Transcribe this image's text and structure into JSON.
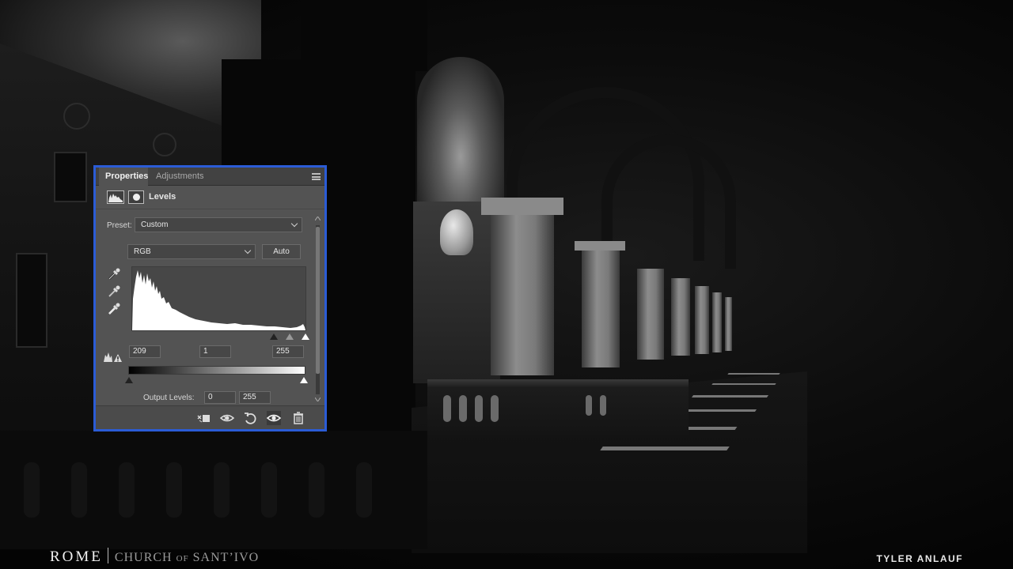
{
  "panel": {
    "tabs": [
      {
        "label": "Properties",
        "active": true
      },
      {
        "label": "Adjustments",
        "active": false
      }
    ],
    "menu_icon": "panel-menu-icon",
    "title": "Levels",
    "preset_label": "Preset:",
    "preset_value": "Custom",
    "channel_value": "RGB",
    "auto_label": "Auto",
    "input_black": "209",
    "input_gamma": "1",
    "input_white": "255",
    "output_label": "Output Levels:",
    "output_black": "0",
    "output_white": "255",
    "footer_icons": [
      "clip-to-layer-icon",
      "view-previous-state-icon",
      "reset-icon",
      "visibility-eye-icon",
      "trash-icon"
    ]
  },
  "caption": {
    "title": "ROME",
    "subtitle_a": "CHURCH",
    "subtitle_of": "OF",
    "subtitle_b": "SANT’IVO",
    "author": "TYLER ANLAUF"
  },
  "colors": {
    "panel_bg": "#535353",
    "panel_border": "#2b5cd6",
    "histogram_fill": "#ffffff"
  }
}
